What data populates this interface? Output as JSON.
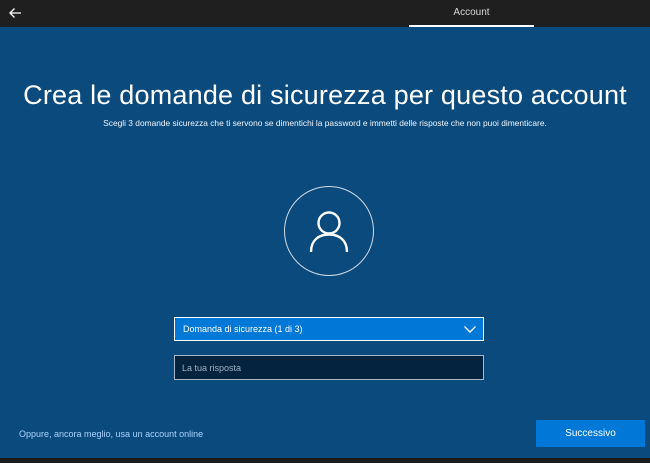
{
  "topbar": {
    "back_icon": "arrow-left-icon",
    "tab_label": "Account"
  },
  "main": {
    "title": "Crea le domande di sicurezza per questo account",
    "subtitle": "Scegli 3 domande sicurezza che ti servono se dimentichi la password e immetti delle risposte che non puoi dimenticare.",
    "avatar_icon": "user-icon"
  },
  "form": {
    "question_select": {
      "value": "Domanda di sicurezza (1 di 3)",
      "icon": "chevron-down-icon"
    },
    "answer": {
      "value": "",
      "placeholder": "La tua risposta"
    }
  },
  "footer": {
    "online_account_link": "Oppure, ancora meglio, usa un account online",
    "next_label": "Successivo"
  },
  "colors": {
    "background": "#0b4a7d",
    "accent": "#0078d7",
    "topbar": "#1f1f1f",
    "link": "#a9d4ff",
    "input_background": "#04233f"
  }
}
